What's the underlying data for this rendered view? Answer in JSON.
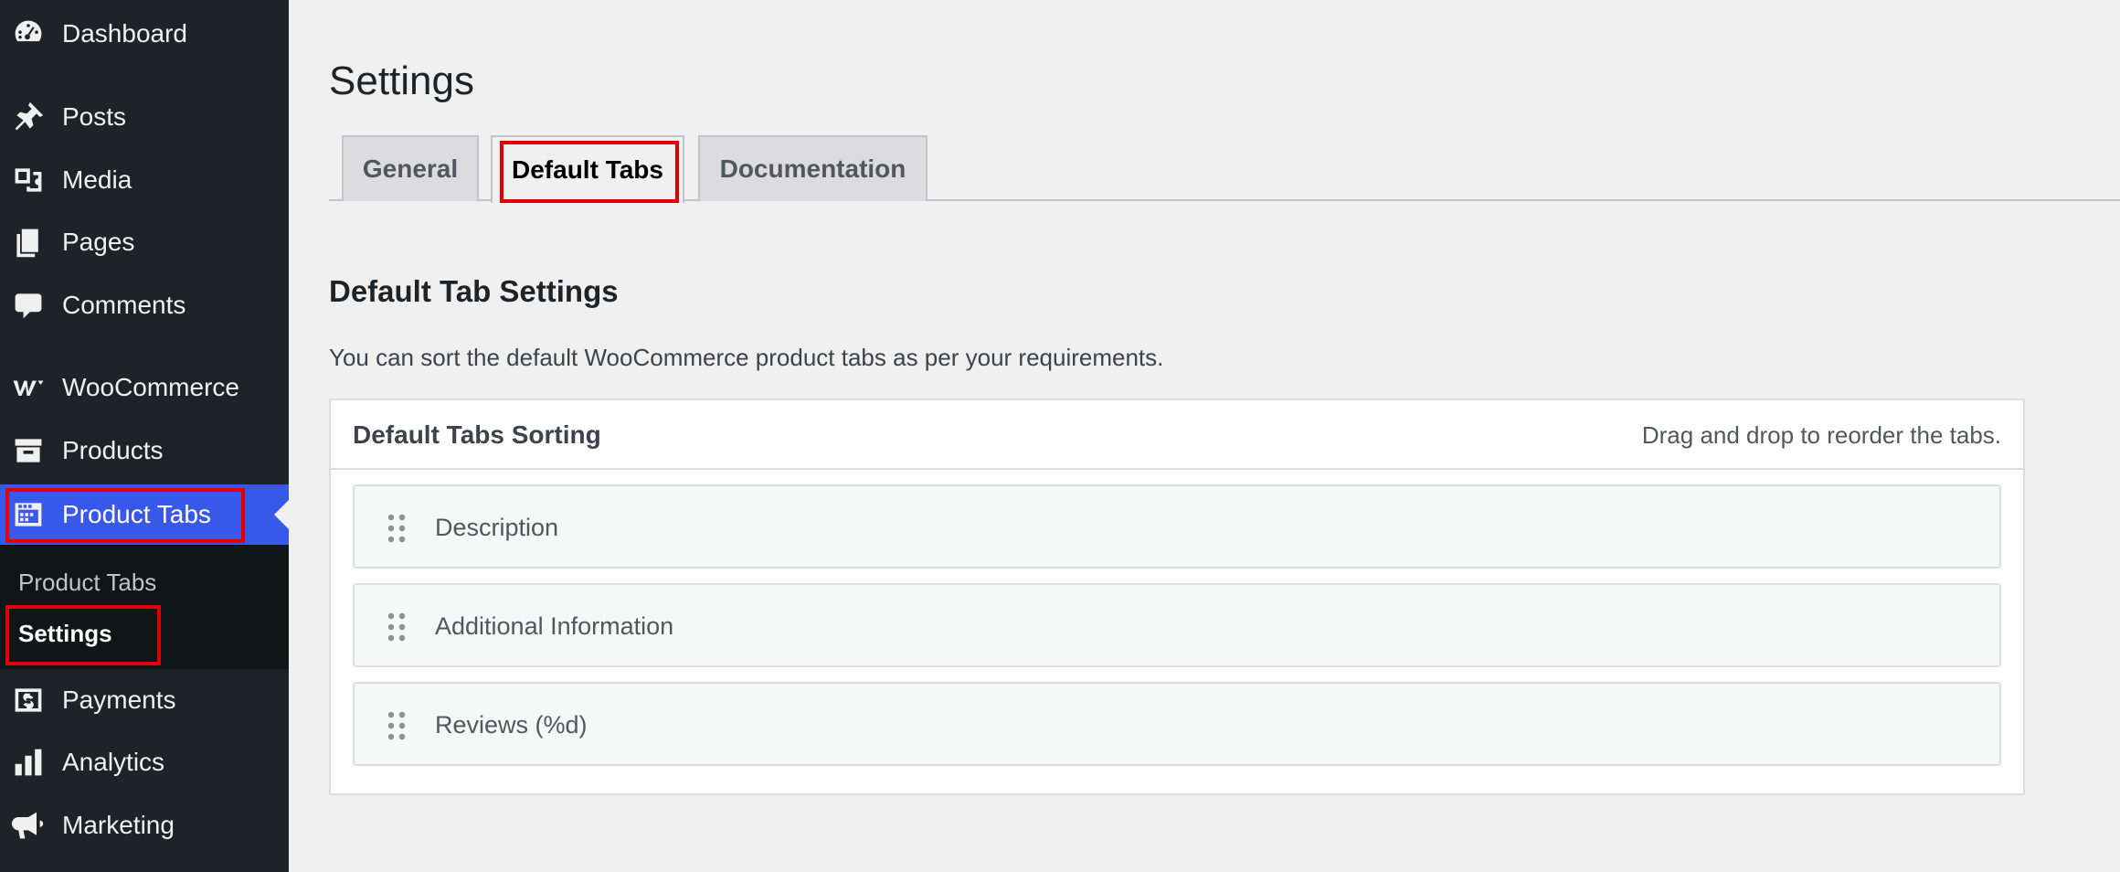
{
  "sidebar": {
    "items": [
      {
        "label": "Dashboard",
        "icon": "dashboard-icon"
      },
      {
        "label": "Posts",
        "icon": "pin-icon"
      },
      {
        "label": "Media",
        "icon": "media-icon"
      },
      {
        "label": "Pages",
        "icon": "pages-icon"
      },
      {
        "label": "Comments",
        "icon": "comment-icon"
      },
      {
        "label": "WooCommerce",
        "icon": "woocommerce-icon"
      },
      {
        "label": "Products",
        "icon": "archive-icon"
      },
      {
        "label": "Product Tabs",
        "icon": "product-tabs-icon"
      },
      {
        "label": "Payments",
        "icon": "dollar-icon"
      },
      {
        "label": "Analytics",
        "icon": "bar-chart-icon"
      },
      {
        "label": "Marketing",
        "icon": "megaphone-icon"
      }
    ],
    "submenu": [
      {
        "label": "Product Tabs"
      },
      {
        "label": "Settings"
      }
    ],
    "accent_color": "#3858e9"
  },
  "main": {
    "title": "Settings",
    "tabs": [
      {
        "label": "General"
      },
      {
        "label": "Default Tabs"
      },
      {
        "label": "Documentation"
      }
    ],
    "section_title": "Default Tab Settings",
    "section_desc": "You can sort the default WooCommerce product tabs as per your requirements.",
    "panel": {
      "title": "Default Tabs Sorting",
      "hint": "Drag and drop to reorder the tabs.",
      "items": [
        {
          "label": "Description"
        },
        {
          "label": "Additional Information"
        },
        {
          "label": "Reviews (%d)"
        }
      ]
    },
    "highlight_color": "#e00000"
  }
}
